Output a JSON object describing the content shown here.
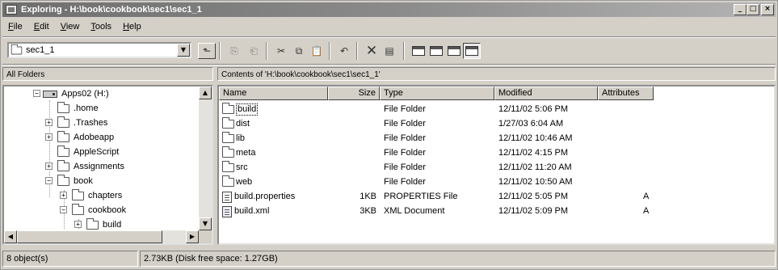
{
  "window": {
    "title": "Exploring - H:\\book\\cookbook\\sec1\\sec1_1",
    "buttons": {
      "minimize": "_",
      "maximize": "□",
      "close": "×"
    }
  },
  "menubar": {
    "items": [
      {
        "label": "File",
        "accel": "F",
        "rest": "ile"
      },
      {
        "label": "Edit",
        "accel": "E",
        "rest": "dit"
      },
      {
        "label": "View",
        "accel": "V",
        "rest": "iew"
      },
      {
        "label": "Tools",
        "accel": "T",
        "rest": "ools"
      },
      {
        "label": "Help",
        "accel": "H",
        "rest": "elp"
      }
    ]
  },
  "toolbar": {
    "address_value": "sec1_1",
    "buttons": [
      "up-folder-icon",
      "map-drive-icon",
      "disconnect-drive-icon",
      "cut-icon",
      "copy-icon",
      "paste-icon",
      "undo-icon",
      "delete-icon",
      "properties-icon",
      "large-icons-view-icon",
      "small-icons-view-icon",
      "list-view-icon",
      "details-view-icon"
    ]
  },
  "panes": {
    "folders_label": "All Folders",
    "contents_label": "Contents of 'H:\\book\\cookbook\\sec1\\sec1_1'"
  },
  "tree": {
    "items": [
      {
        "label": "Apps02 (H:)",
        "expander": "−"
      },
      {
        "label": ".home",
        "expander": ""
      },
      {
        "label": ".Trashes",
        "expander": "+"
      },
      {
        "label": "Adobeapp",
        "expander": "+"
      },
      {
        "label": "AppleScript",
        "expander": ""
      },
      {
        "label": "Assignments",
        "expander": "+"
      },
      {
        "label": "book",
        "expander": "−"
      },
      {
        "label": "chapters",
        "expander": "+"
      },
      {
        "label": "cookbook",
        "expander": "−"
      },
      {
        "label": "build",
        "expander": "+"
      }
    ]
  },
  "list": {
    "columns": {
      "name": "Name",
      "size": "Size",
      "type": "Type",
      "modified": "Modified",
      "attributes": "Attributes"
    },
    "rows": [
      {
        "name": "build",
        "size": "",
        "type": "File Folder",
        "modified": "12/11/02 5:06 PM",
        "attr": "",
        "icon": "folder-icon"
      },
      {
        "name": "dist",
        "size": "",
        "type": "File Folder",
        "modified": "1/27/03 6:04 AM",
        "attr": "",
        "icon": "folder-icon"
      },
      {
        "name": "lib",
        "size": "",
        "type": "File Folder",
        "modified": "12/11/02 10:46 AM",
        "attr": "",
        "icon": "folder-icon"
      },
      {
        "name": "meta",
        "size": "",
        "type": "File Folder",
        "modified": "12/11/02 4:15 PM",
        "attr": "",
        "icon": "folder-icon"
      },
      {
        "name": "src",
        "size": "",
        "type": "File Folder",
        "modified": "12/11/02 11:20 AM",
        "attr": "",
        "icon": "folder-icon"
      },
      {
        "name": "web",
        "size": "",
        "type": "File Folder",
        "modified": "12/11/02 10:50 AM",
        "attr": "",
        "icon": "folder-icon"
      },
      {
        "name": "build.properties",
        "size": "1KB",
        "type": "PROPERTIES File",
        "modified": "12/11/02 5:05 PM",
        "attr": "A",
        "icon": "file-icon"
      },
      {
        "name": "build.xml",
        "size": "3KB",
        "type": "XML Document",
        "modified": "12/11/02 5:09 PM",
        "attr": "A",
        "icon": "xml-file-icon"
      }
    ]
  },
  "status": {
    "objects": "8 object(s)",
    "size": "2.73KB (Disk free space: 1.27GB)"
  }
}
